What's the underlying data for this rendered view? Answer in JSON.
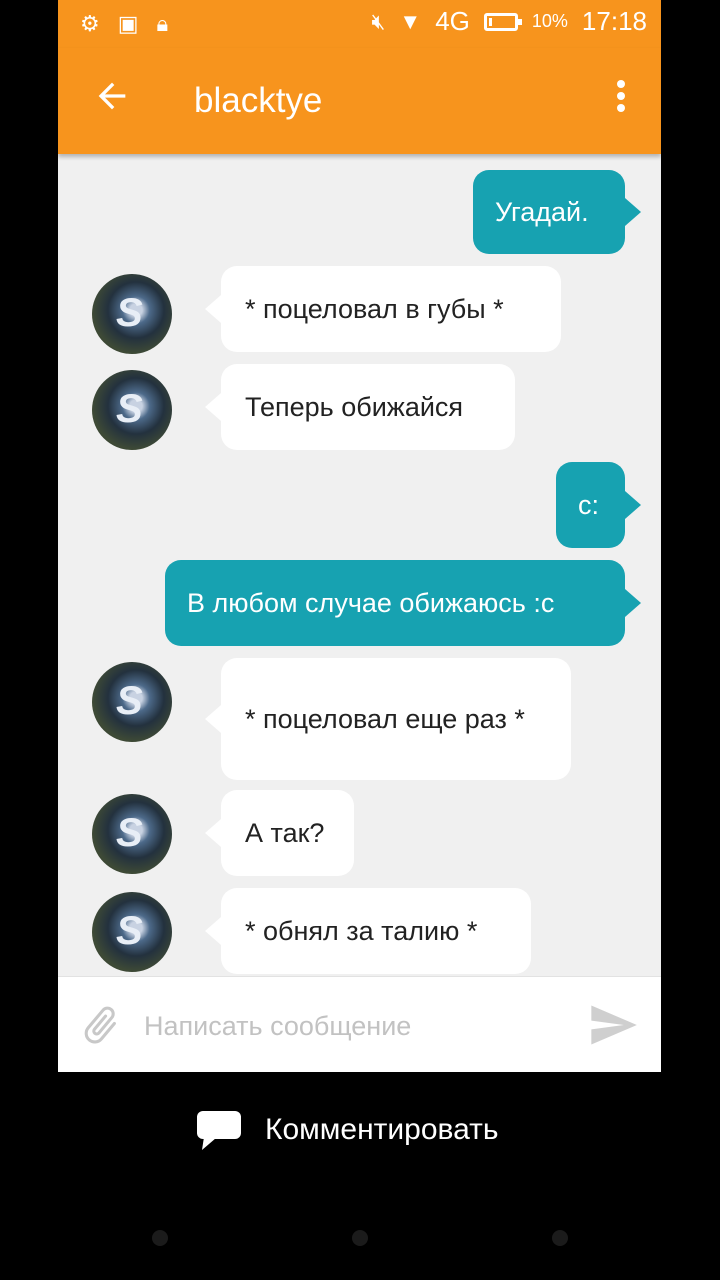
{
  "status_bar": {
    "network": "4G",
    "battery_percent": "10%",
    "time": "17:18"
  },
  "toolbar": {
    "title": "blacktye",
    "back_icon": "arrow-left-icon",
    "menu_icon": "more-vertical-icon"
  },
  "messages": [
    {
      "direction": "out",
      "text": "Угадай."
    },
    {
      "direction": "in",
      "text": "* поцеловал в губы *"
    },
    {
      "direction": "in",
      "text": "Теперь обижайся"
    },
    {
      "direction": "out",
      "text": "с:"
    },
    {
      "direction": "out",
      "text": "В любом случае обижаюсь :с"
    },
    {
      "direction": "in",
      "text": "* поцеловал еще раз *"
    },
    {
      "direction": "in",
      "text": "А так?"
    },
    {
      "direction": "in",
      "text": "* обнял за талию *"
    }
  ],
  "composer": {
    "placeholder": "Написать сообщение",
    "value": ""
  },
  "footer": {
    "comment_label": "Комментировать"
  },
  "colors": {
    "accent": "#f7941d",
    "outgoing_bubble": "#17a2b1",
    "incoming_bubble": "#ffffff",
    "chat_background": "#f0f0f0"
  }
}
